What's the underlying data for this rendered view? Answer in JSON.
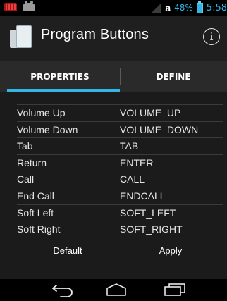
{
  "status_bar": {
    "carrier_letter": "a",
    "battery_percent": "48%",
    "time": "5:58"
  },
  "action_bar": {
    "title": "Program Buttons",
    "info_symbol": "i"
  },
  "tabs": [
    {
      "label": "PROPERTIES",
      "selected": true
    },
    {
      "label": "DEFINE",
      "selected": false
    }
  ],
  "mappings": [
    {
      "name": "Volume Up",
      "value": "VOLUME_UP"
    },
    {
      "name": "Volume Down",
      "value": "VOLUME_DOWN"
    },
    {
      "name": "Tab",
      "value": "TAB"
    },
    {
      "name": "Return",
      "value": "ENTER"
    },
    {
      "name": "Call",
      "value": "CALL"
    },
    {
      "name": "End Call",
      "value": "ENDCALL"
    },
    {
      "name": "Soft Left",
      "value": "SOFT_LEFT"
    },
    {
      "name": "Soft Right",
      "value": "SOFT_RIGHT"
    }
  ],
  "buttons": {
    "default_label": "Default",
    "apply_label": "Apply"
  },
  "colors": {
    "accent": "#33b5e5",
    "background": "#1c1c1c"
  },
  "icons": {
    "status_left": [
      "notification-icon",
      "android-debug-icon"
    ],
    "nav": [
      "back-icon",
      "home-icon",
      "recent-apps-icon"
    ]
  }
}
